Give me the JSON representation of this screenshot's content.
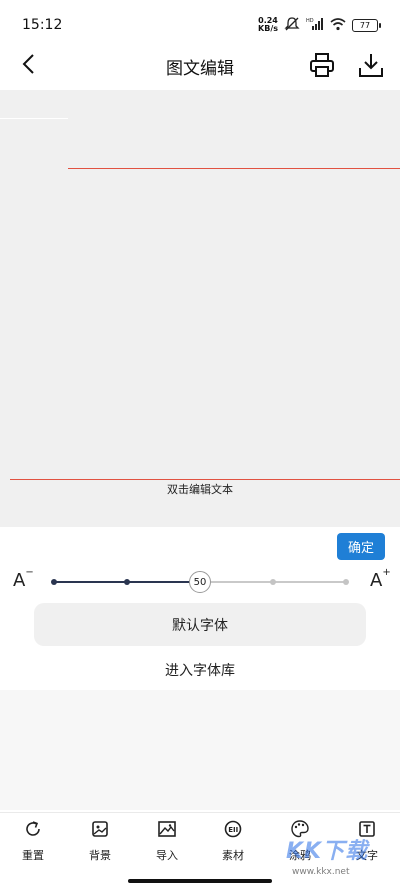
{
  "status_bar": {
    "time": "15:12",
    "net_speed_value": "0.24",
    "net_speed_unit": "KB/s",
    "hd_label": "HD",
    "battery": "77"
  },
  "header": {
    "title": "图文编辑"
  },
  "canvas": {
    "hint_text": "双击编辑文本"
  },
  "confirm_label": "确定",
  "font_size": {
    "value": "50",
    "level": 0.5,
    "decrease_label": "A",
    "increase_label": "A"
  },
  "font": {
    "current": "默认字体",
    "library_link": "进入字体库"
  },
  "toolbar": {
    "items": [
      {
        "label": "重置",
        "icon": "reset-icon"
      },
      {
        "label": "背景",
        "icon": "background-icon"
      },
      {
        "label": "导入",
        "icon": "import-image-icon"
      },
      {
        "label": "素材",
        "icon": "material-icon"
      },
      {
        "label": "涂鸦",
        "icon": "palette-icon"
      },
      {
        "label": "文字",
        "icon": "text-icon"
      }
    ]
  },
  "watermark": {
    "text": "KK下载",
    "url": "www.kkx.net"
  },
  "colors": {
    "accent": "#1f7fd6",
    "slider_active": "#2a3550",
    "guide_line": "#e15241",
    "canvas_bg": "#f0f0f0"
  }
}
